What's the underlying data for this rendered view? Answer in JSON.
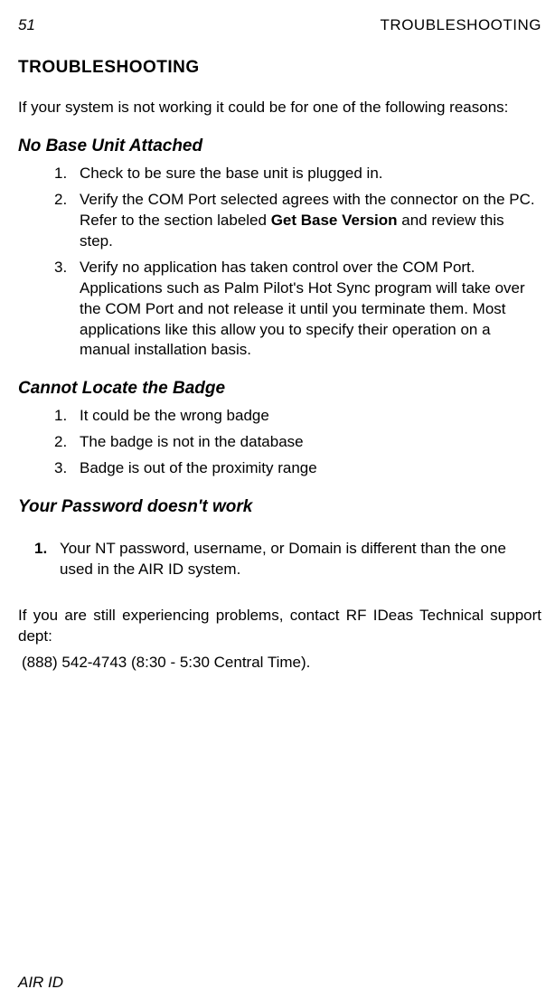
{
  "header": {
    "page_number": "51",
    "title": "TROUBLESHOOTING"
  },
  "main_title": "TROUBLESHOOTING",
  "intro": "If your system is not working it could be for one of the following reasons:",
  "section1": {
    "title": "No Base Unit Attached",
    "items": [
      {
        "num": "1.",
        "text": "Check to be sure the base unit is plugged in."
      },
      {
        "num": "2.",
        "pre": "Verify the COM Port selected agrees with the connector on the PC. Refer to the section labeled ",
        "bold": "Get Base Version",
        "post": " and review this step."
      },
      {
        "num": "3.",
        "text": "Verify no application has taken control over the COM Port. Applications such as Palm Pilot's Hot Sync program will take over the COM Port and not release it until you terminate them.  Most applications like this allow you to specify their operation on a manual installation basis."
      }
    ]
  },
  "section2": {
    "title": "Cannot Locate the Badge",
    "items": [
      {
        "num": "1.",
        "text": "It could be the wrong badge"
      },
      {
        "num": "2.",
        "text": "The badge is not in the database"
      },
      {
        "num": "3.",
        "text": "Badge is out of the proximity range"
      }
    ]
  },
  "section3": {
    "title": "Your Password doesn't work",
    "items": [
      {
        "num": "1.",
        "text": "Your NT password, username, or Domain is different than the one used in the AIR ID system."
      }
    ]
  },
  "closing": "If you are still experiencing problems, contact RF IDeas Technical support dept:",
  "phone": "(888) 542-4743 (8:30 - 5:30 Central Time).",
  "footer": "AIR ID"
}
